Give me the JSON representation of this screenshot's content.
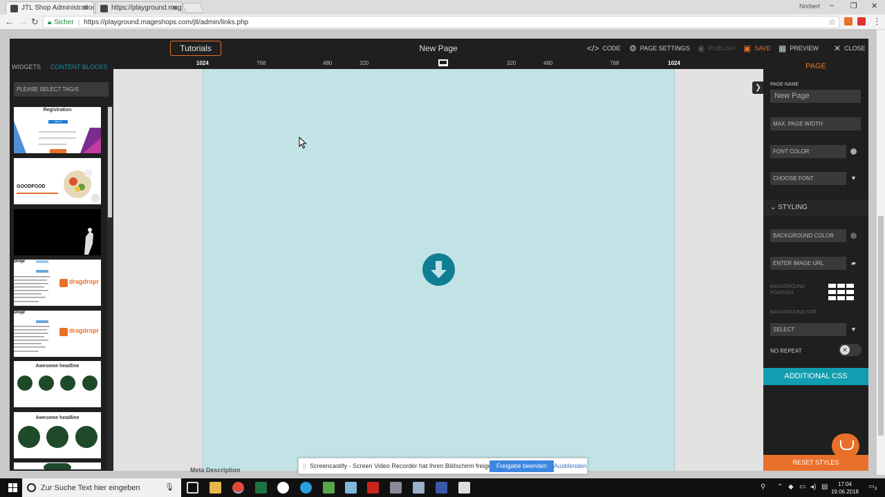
{
  "browser": {
    "tabs": [
      {
        "title": "JTL Shop Administration",
        "active": true
      },
      {
        "title": "https://playground.mage",
        "active": false
      }
    ],
    "window_user": "Norbert",
    "secure_label": "Sicher",
    "url": "https://playground.mageshops.com/jtl/admin/links.php"
  },
  "editor": {
    "tutorials_label": "Tutorials",
    "page_title": "New Page",
    "toolbar": {
      "code": "CODE",
      "page_settings": "PAGE SETTINGS",
      "publish": "PUBLISH",
      "save": "SAVE",
      "preview": "PREVIEW",
      "close": "CLOSE"
    }
  },
  "left_panel": {
    "tab_widgets": "WIDGETS",
    "tab_content_blocks": "CONTENT BLOCKS",
    "tag_select": "PLEASE SELECT TAG/S",
    "thumbnails": [
      {
        "title": "Registration",
        "button": "Sign up"
      },
      {
        "title": "GOODFOOD"
      },
      {
        "title": ""
      },
      {
        "title": "Dropr",
        "brand": "dragdropr"
      },
      {
        "title": "Dropr",
        "brand": "dragdropr"
      },
      {
        "title": "Awesome headline"
      },
      {
        "title": "Awesome headline"
      }
    ]
  },
  "ruler": {
    "labels": [
      "1024",
      "768",
      "480",
      "320",
      "320",
      "480",
      "768",
      "1024"
    ]
  },
  "right_panel": {
    "heading": "PAGE",
    "page_name_label": "PAGE NAME",
    "page_name_value": "New Page",
    "max_width_placeholder": "MAX. PAGE WIDTH",
    "font_color": "FONT COLOR",
    "choose_font": "CHOOSE FONT",
    "styling": "STYLING",
    "background_color": "BACKGROUND COLOR",
    "image_url": "ENTER IMAGE URL",
    "background_position": "BACKGROUND POSITION",
    "background_size": "BACKGROUND SIZE",
    "select": "SELECT",
    "no_repeat": "NO REPEAT",
    "additional_css": "ADDITIONAL CSS",
    "reset_styles": "RESET STYLES"
  },
  "notification": {
    "message": "Screencastify - Screen Video Recorder hat Ihren Bildschirm freigegeben.",
    "primary": "Freigabe beenden",
    "secondary": "Ausblenden"
  },
  "behind_text": "Meta Description",
  "taskbar": {
    "search_placeholder": "Zur Suche Text hier eingeben",
    "time": "17:04",
    "date": "19.06.2018",
    "notifications": "3"
  },
  "colors": {
    "accent_orange": "#e8702a",
    "accent_teal": "#109eb0",
    "canvas_bg": "#c2e3e5",
    "panel_bg": "#1f1f1f"
  }
}
